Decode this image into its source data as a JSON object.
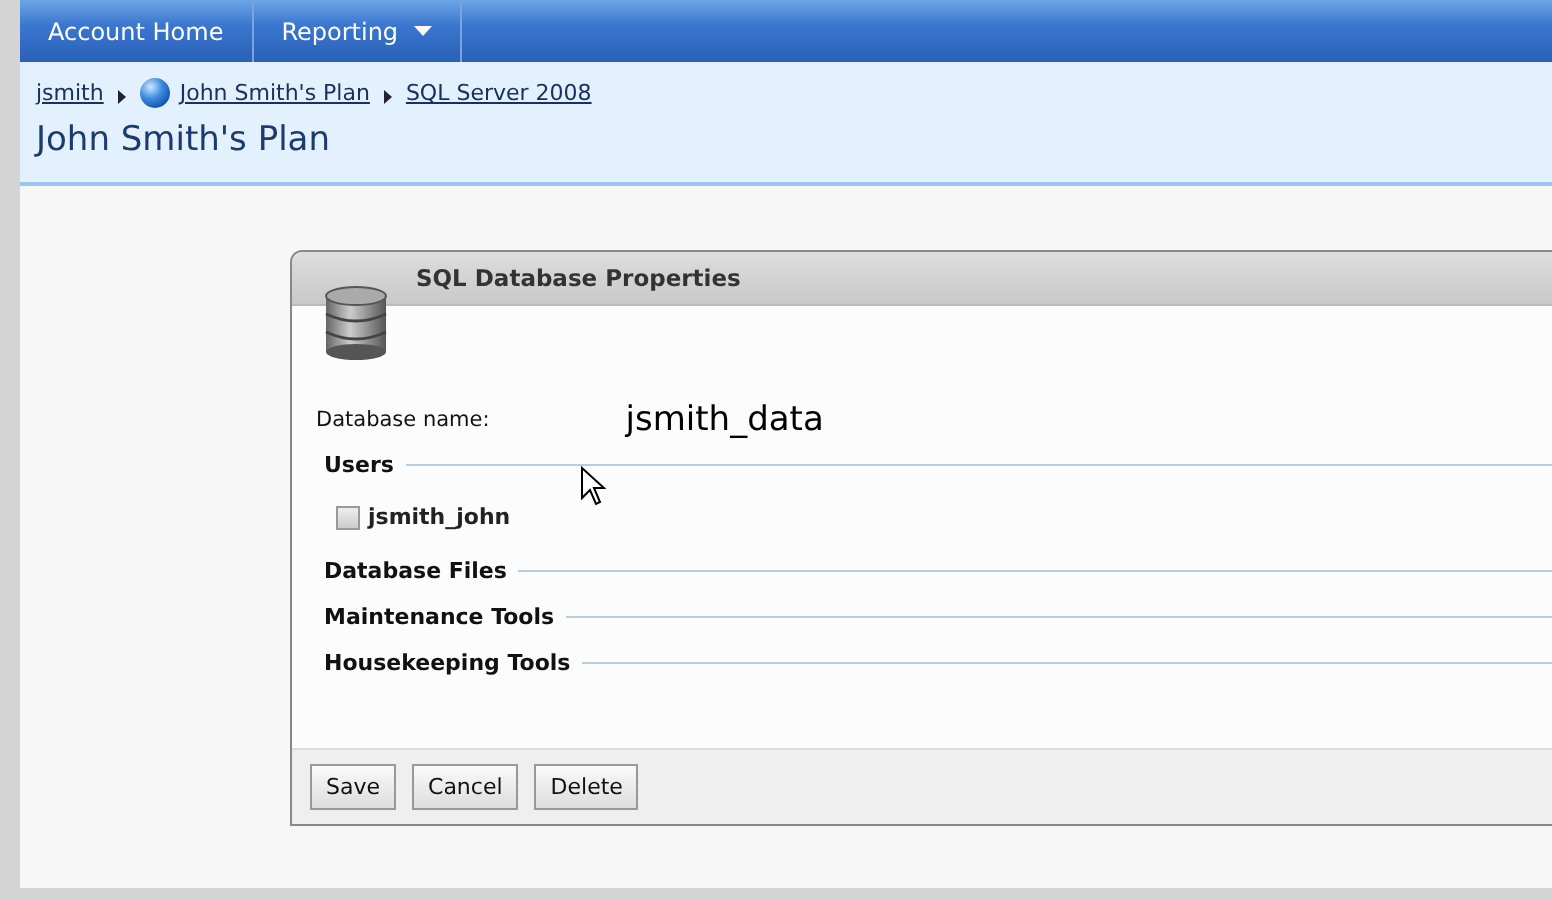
{
  "nav": {
    "items": [
      {
        "label": "Account Home",
        "dropdown": false
      },
      {
        "label": "Reporting",
        "dropdown": true
      }
    ]
  },
  "breadcrumb": [
    {
      "label": "jsmith",
      "globe": false
    },
    {
      "label": "John Smith's Plan",
      "globe": true
    },
    {
      "label": "SQL Server 2008",
      "globe": false
    }
  ],
  "page_title": "John Smith's Plan",
  "dialog": {
    "title": "SQL Database Properties",
    "name_label": "Database name:",
    "name_value": "jsmith_data",
    "sections": [
      {
        "title": "Users",
        "users": [
          {
            "label": "jsmith_john",
            "checked": false
          }
        ]
      },
      {
        "title": "Database Files"
      },
      {
        "title": "Maintenance Tools"
      },
      {
        "title": "Housekeeping Tools"
      }
    ],
    "buttons": [
      "Save",
      "Cancel",
      "Delete"
    ]
  }
}
